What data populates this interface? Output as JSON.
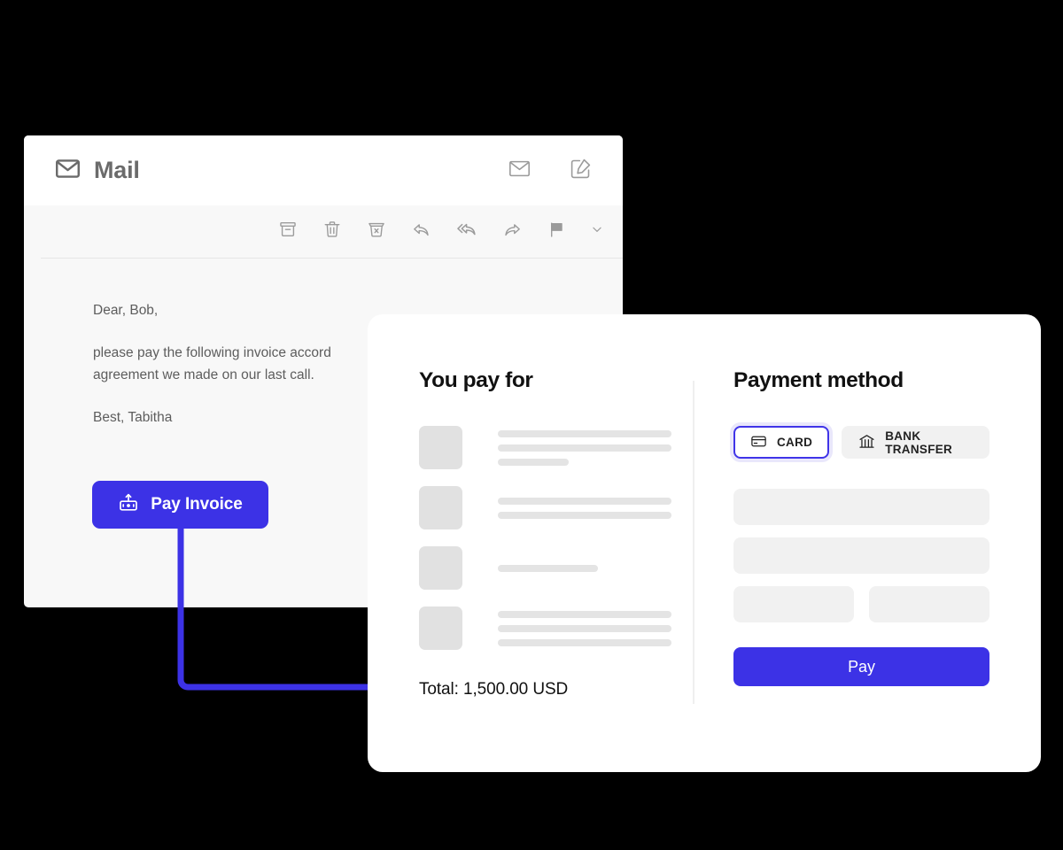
{
  "theme": {
    "background": "#000000",
    "accent": "#3c32e6",
    "accent_border": "#4034e8",
    "card_background": "#ffffff",
    "mail_body_background": "#f8f8f8",
    "skeleton_gray": "#e4e4e4",
    "field_gray": "#f1f1f1",
    "text_dark": "#111111",
    "text_muted": "#5d5d5d"
  },
  "mail": {
    "brand_label": "Mail",
    "brand_icon": "envelope-icon",
    "header_actions": [
      {
        "name": "envelope-icon",
        "title": "Inbox"
      },
      {
        "name": "compose-icon",
        "title": "Compose"
      }
    ],
    "toolbar_icons": [
      {
        "name": "archive-icon",
        "title": "Archive"
      },
      {
        "name": "trash-icon",
        "title": "Delete"
      },
      {
        "name": "junk-icon",
        "title": "Mark as junk"
      },
      {
        "name": "reply-icon",
        "title": "Reply"
      },
      {
        "name": "reply-all-icon",
        "title": "Reply all"
      },
      {
        "name": "forward-icon",
        "title": "Forward"
      },
      {
        "name": "flag-icon",
        "title": "Flag"
      },
      {
        "name": "chevron-down-icon",
        "title": "More"
      }
    ],
    "body": {
      "greeting": "Dear, Bob,",
      "paragraph_line1": "please pay the following invoice accord",
      "paragraph_line2": "agreement we made on our last call.",
      "signoff": "Best, Tabitha"
    },
    "pay_invoice_button": {
      "label": "Pay Invoice",
      "icon": "send-money-icon"
    }
  },
  "payment": {
    "left": {
      "title": "You pay for",
      "total_label": "Total: 1,500.00 USD",
      "items": [
        {
          "lines": [
            "full",
            "full",
            "short"
          ]
        },
        {
          "lines": [
            "full",
            "full"
          ]
        },
        {
          "lines": [
            "mid"
          ]
        },
        {
          "lines": [
            "full",
            "full",
            "full"
          ]
        }
      ]
    },
    "right": {
      "title": "Payment method",
      "methods": [
        {
          "label": "CARD",
          "icon": "credit-card-icon",
          "selected": true
        },
        {
          "label": "BANK TRANSFER",
          "icon": "bank-icon",
          "selected": false
        }
      ],
      "fields": [
        {
          "type": "full"
        },
        {
          "type": "full"
        },
        {
          "type": "split"
        }
      ],
      "pay_button_label": "Pay"
    }
  },
  "connector": {
    "color": "#3c32e6",
    "description": "arrow-from-pay-invoice-to-total"
  }
}
